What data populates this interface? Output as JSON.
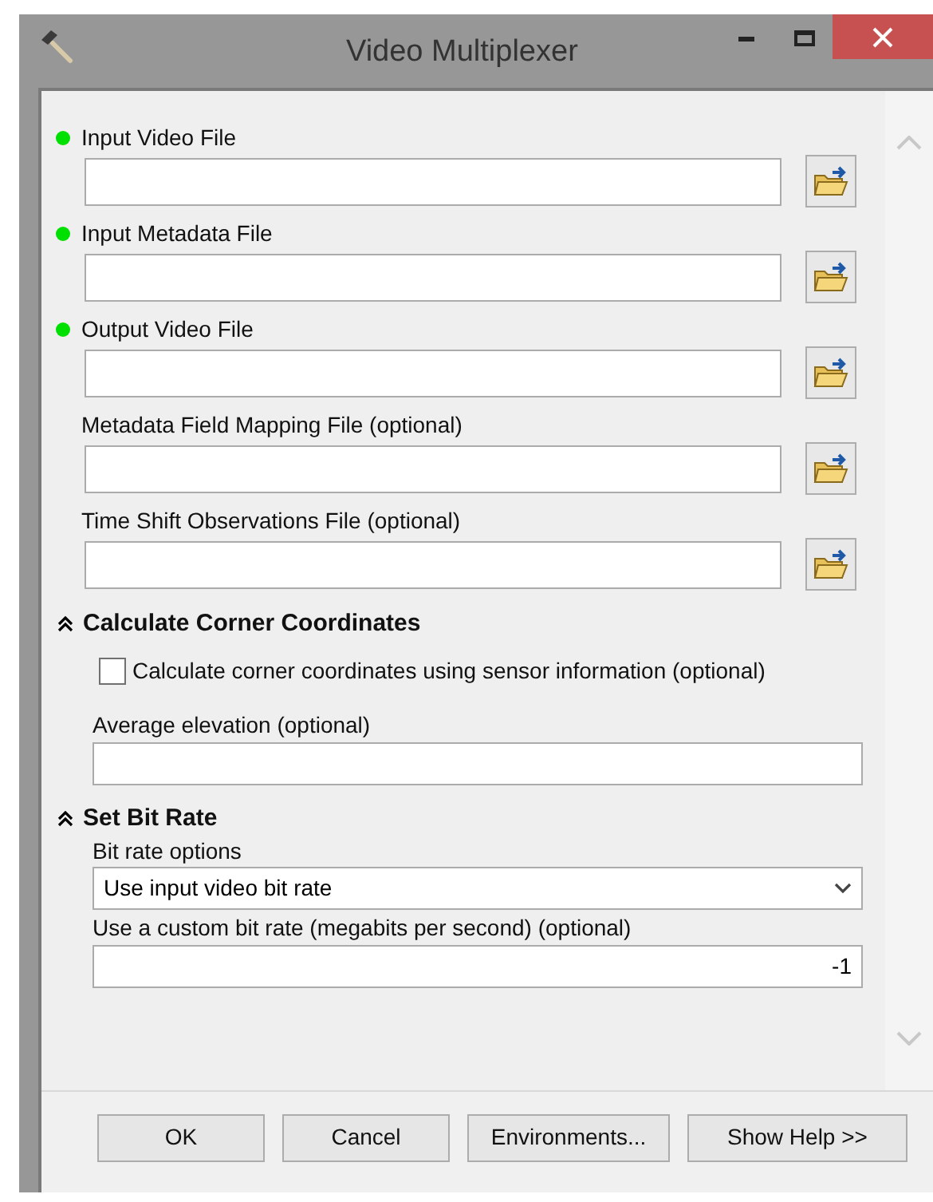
{
  "window": {
    "title": "Video Multiplexer"
  },
  "file_params": [
    {
      "label": "Input Video File",
      "required": true
    },
    {
      "label": "Input Metadata File",
      "required": true
    },
    {
      "label": "Output Video File",
      "required": true
    },
    {
      "label": "Metadata Field Mapping File (optional)",
      "required": false
    },
    {
      "label": "Time Shift Observations File (optional)",
      "required": false
    }
  ],
  "sections": [
    {
      "title": "Calculate Corner Coordinates",
      "expanded": true,
      "items": [
        {
          "kind": "checkbox",
          "label": "Calculate corner coordinates using sensor information (optional)",
          "checked": false
        },
        {
          "kind": "text",
          "label": "Average elevation (optional)"
        }
      ]
    },
    {
      "title": "Set Bit Rate",
      "expanded": true,
      "items": [
        {
          "kind": "dropdown",
          "label": "Bit rate options",
          "value": "Use input video bit rate"
        },
        {
          "kind": "number",
          "label": "Use a custom bit rate (megabits per second) (optional)",
          "value": "-1"
        }
      ]
    }
  ],
  "buttons": [
    "OK",
    "Cancel",
    "Environments...",
    "Show Help >>"
  ]
}
